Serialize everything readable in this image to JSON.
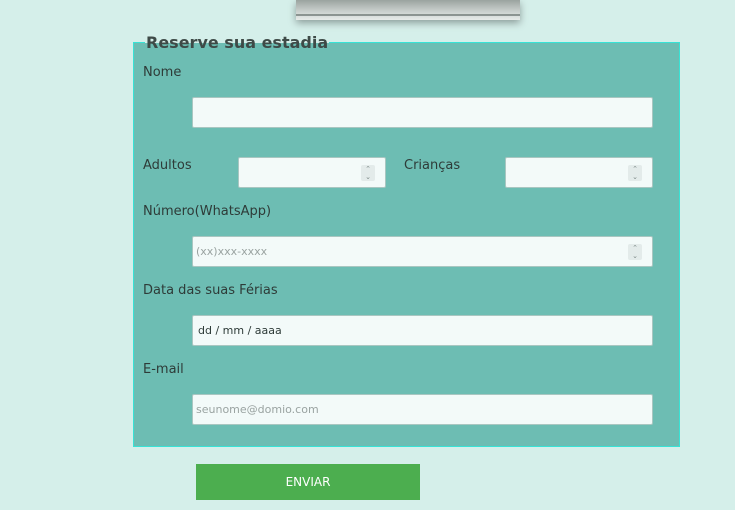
{
  "form": {
    "legend": "Reserve sua estadia",
    "name_label": "Nome",
    "name_value": "",
    "adults_label": "Adultos",
    "adults_value": "",
    "children_label": "Crianças",
    "children_value": "",
    "whatsapp_label": "Número(WhatsApp)",
    "whatsapp_placeholder": "(xx)xxx-xxxx",
    "date_label": "Data das suas Férias",
    "date_value": "dd / mm / aaaa",
    "email_label": "E-mail",
    "email_placeholder": "seunome@domio.com",
    "submit_label": "ENVIAR"
  },
  "icons": {
    "spinner": "number-spinner-icon"
  },
  "colors": {
    "page_background": "#d5efea",
    "form_background": "#6dbdb3",
    "form_border": "#37e3d6",
    "submit_button": "#4cae4f"
  }
}
